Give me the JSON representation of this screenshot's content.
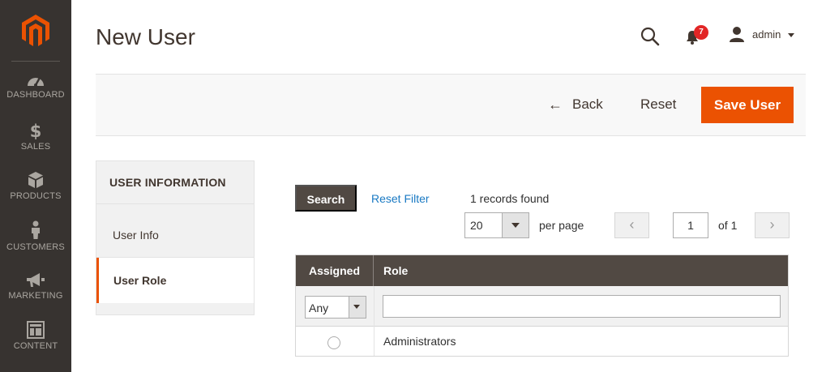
{
  "brand": {
    "accent": "#eb5202",
    "nav_bg": "#373330",
    "logo_icon": "magento-logo-icon"
  },
  "nav": {
    "items": [
      {
        "label": "DASHBOARD",
        "icon": "dashboard-icon"
      },
      {
        "label": "SALES",
        "icon": "dollar-icon"
      },
      {
        "label": "PRODUCTS",
        "icon": "box-icon"
      },
      {
        "label": "CUSTOMERS",
        "icon": "person-icon"
      },
      {
        "label": "MARKETING",
        "icon": "megaphone-icon"
      },
      {
        "label": "CONTENT",
        "icon": "layout-icon"
      }
    ]
  },
  "header": {
    "title": "New User",
    "notifications_count": "7",
    "user": "admin"
  },
  "actions": {
    "back": "Back",
    "reset": "Reset",
    "save": "Save User"
  },
  "tabs": {
    "title": "USER INFORMATION",
    "items": [
      {
        "label": "User Info",
        "active": false
      },
      {
        "label": "User Role",
        "active": true
      }
    ]
  },
  "grid": {
    "search_label": "Search",
    "reset_filter_label": "Reset Filter",
    "records_text": "1 records found",
    "per_page_value": "20",
    "per_page_label": "per page",
    "page_current": "1",
    "page_of": "of 1",
    "columns": [
      "Assigned",
      "Role"
    ],
    "filter_assigned": "Any",
    "filter_role": "",
    "rows": [
      {
        "assigned": false,
        "role": "Administrators"
      }
    ]
  }
}
